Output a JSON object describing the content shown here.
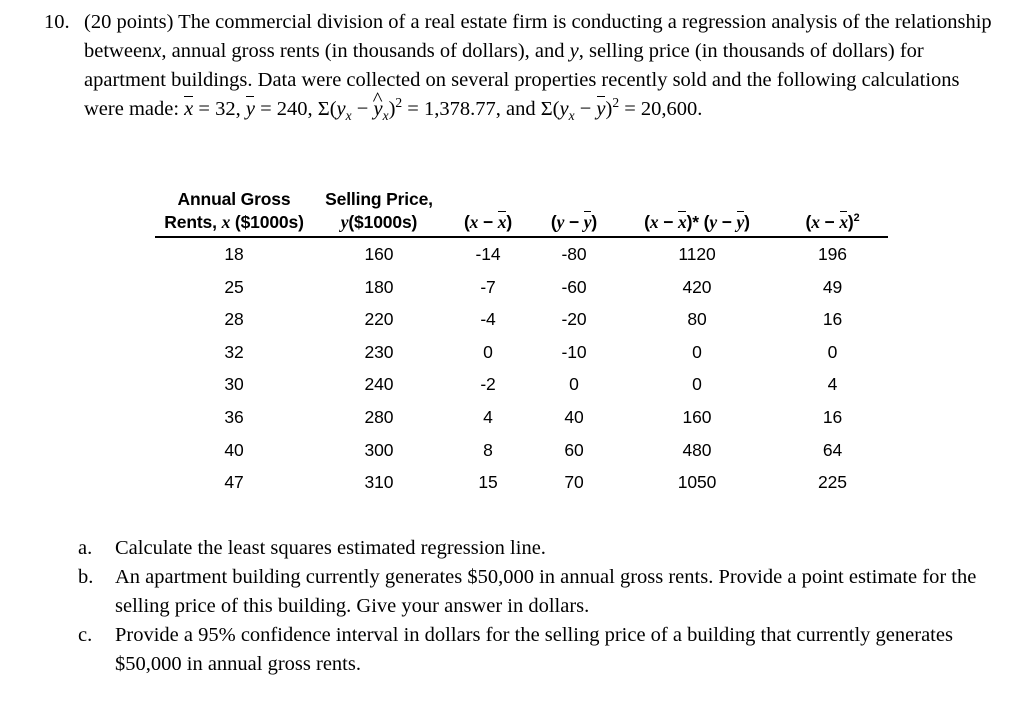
{
  "problem": {
    "number": "10.",
    "points_label": "(20 points)",
    "text_part_1": "The commercial division of a real estate firm is conducting a regression analysis of the relationship between",
    "var_x": "x",
    "text_part_2": ", annual gross rents (in thousands of dollars), and",
    "var_y": "y",
    "text_part_3": ", selling price (in thousands of dollars) for apartment buildings. Data were collected on several properties recently sold and the following calculations were made:",
    "stat_xbar_var": "x",
    "stat_xbar_value": "32",
    "stat_ybar_var": "y",
    "stat_ybar_value": "240",
    "sse_value": "1,378.77",
    "sst_value": "20,600",
    "and_label": "and",
    "equals": "=",
    "comma": ",",
    "period": "."
  },
  "table": {
    "headers": [
      {
        "line1": "Annual Gross",
        "line2_pre": "Rents,",
        "line2_var": "x",
        "line2_post": "($1000s)"
      },
      {
        "line1": "Selling Price,",
        "line2_var": "y",
        "line2_post": "($1000s)"
      },
      {
        "math": "(x - xbar)"
      },
      {
        "math": "(y - ybar)"
      },
      {
        "math": "(x - xbar)*(y - ybar)"
      },
      {
        "math": "(x - xbar)^2"
      }
    ],
    "header_symbols": {
      "x": "x",
      "y": "y",
      "minus": "−",
      "star": "*",
      "lparen": "(",
      "rparen": ")",
      "exp2": "2"
    },
    "rows": [
      [
        "18",
        "160",
        "-14",
        "-80",
        "1120",
        "196"
      ],
      [
        "25",
        "180",
        "-7",
        "-60",
        "420",
        "49"
      ],
      [
        "28",
        "220",
        "-4",
        "-20",
        "80",
        "16"
      ],
      [
        "32",
        "230",
        "0",
        "-10",
        "0",
        "0"
      ],
      [
        "30",
        "240",
        "-2",
        "0",
        "0",
        "4"
      ],
      [
        "36",
        "280",
        "4",
        "40",
        "160",
        "16"
      ],
      [
        "40",
        "300",
        "8",
        "60",
        "480",
        "64"
      ],
      [
        "47",
        "310",
        "15",
        "70",
        "1050",
        "225"
      ]
    ]
  },
  "subquestions": [
    {
      "letter": "a.",
      "text": "Calculate the least squares estimated regression line."
    },
    {
      "letter": "b.",
      "text": "An apartment building currently generates $50,000 in annual gross rents. Provide a point estimate for the selling price of this building. Give your answer in dollars."
    },
    {
      "letter": "c.",
      "text": "Provide a 95% confidence interval in dollars for the selling price of a building that currently generates $50,000 in annual gross rents."
    }
  ],
  "colors": {
    "background": "#ffffff",
    "text": "#000000",
    "rule": "#000000"
  }
}
